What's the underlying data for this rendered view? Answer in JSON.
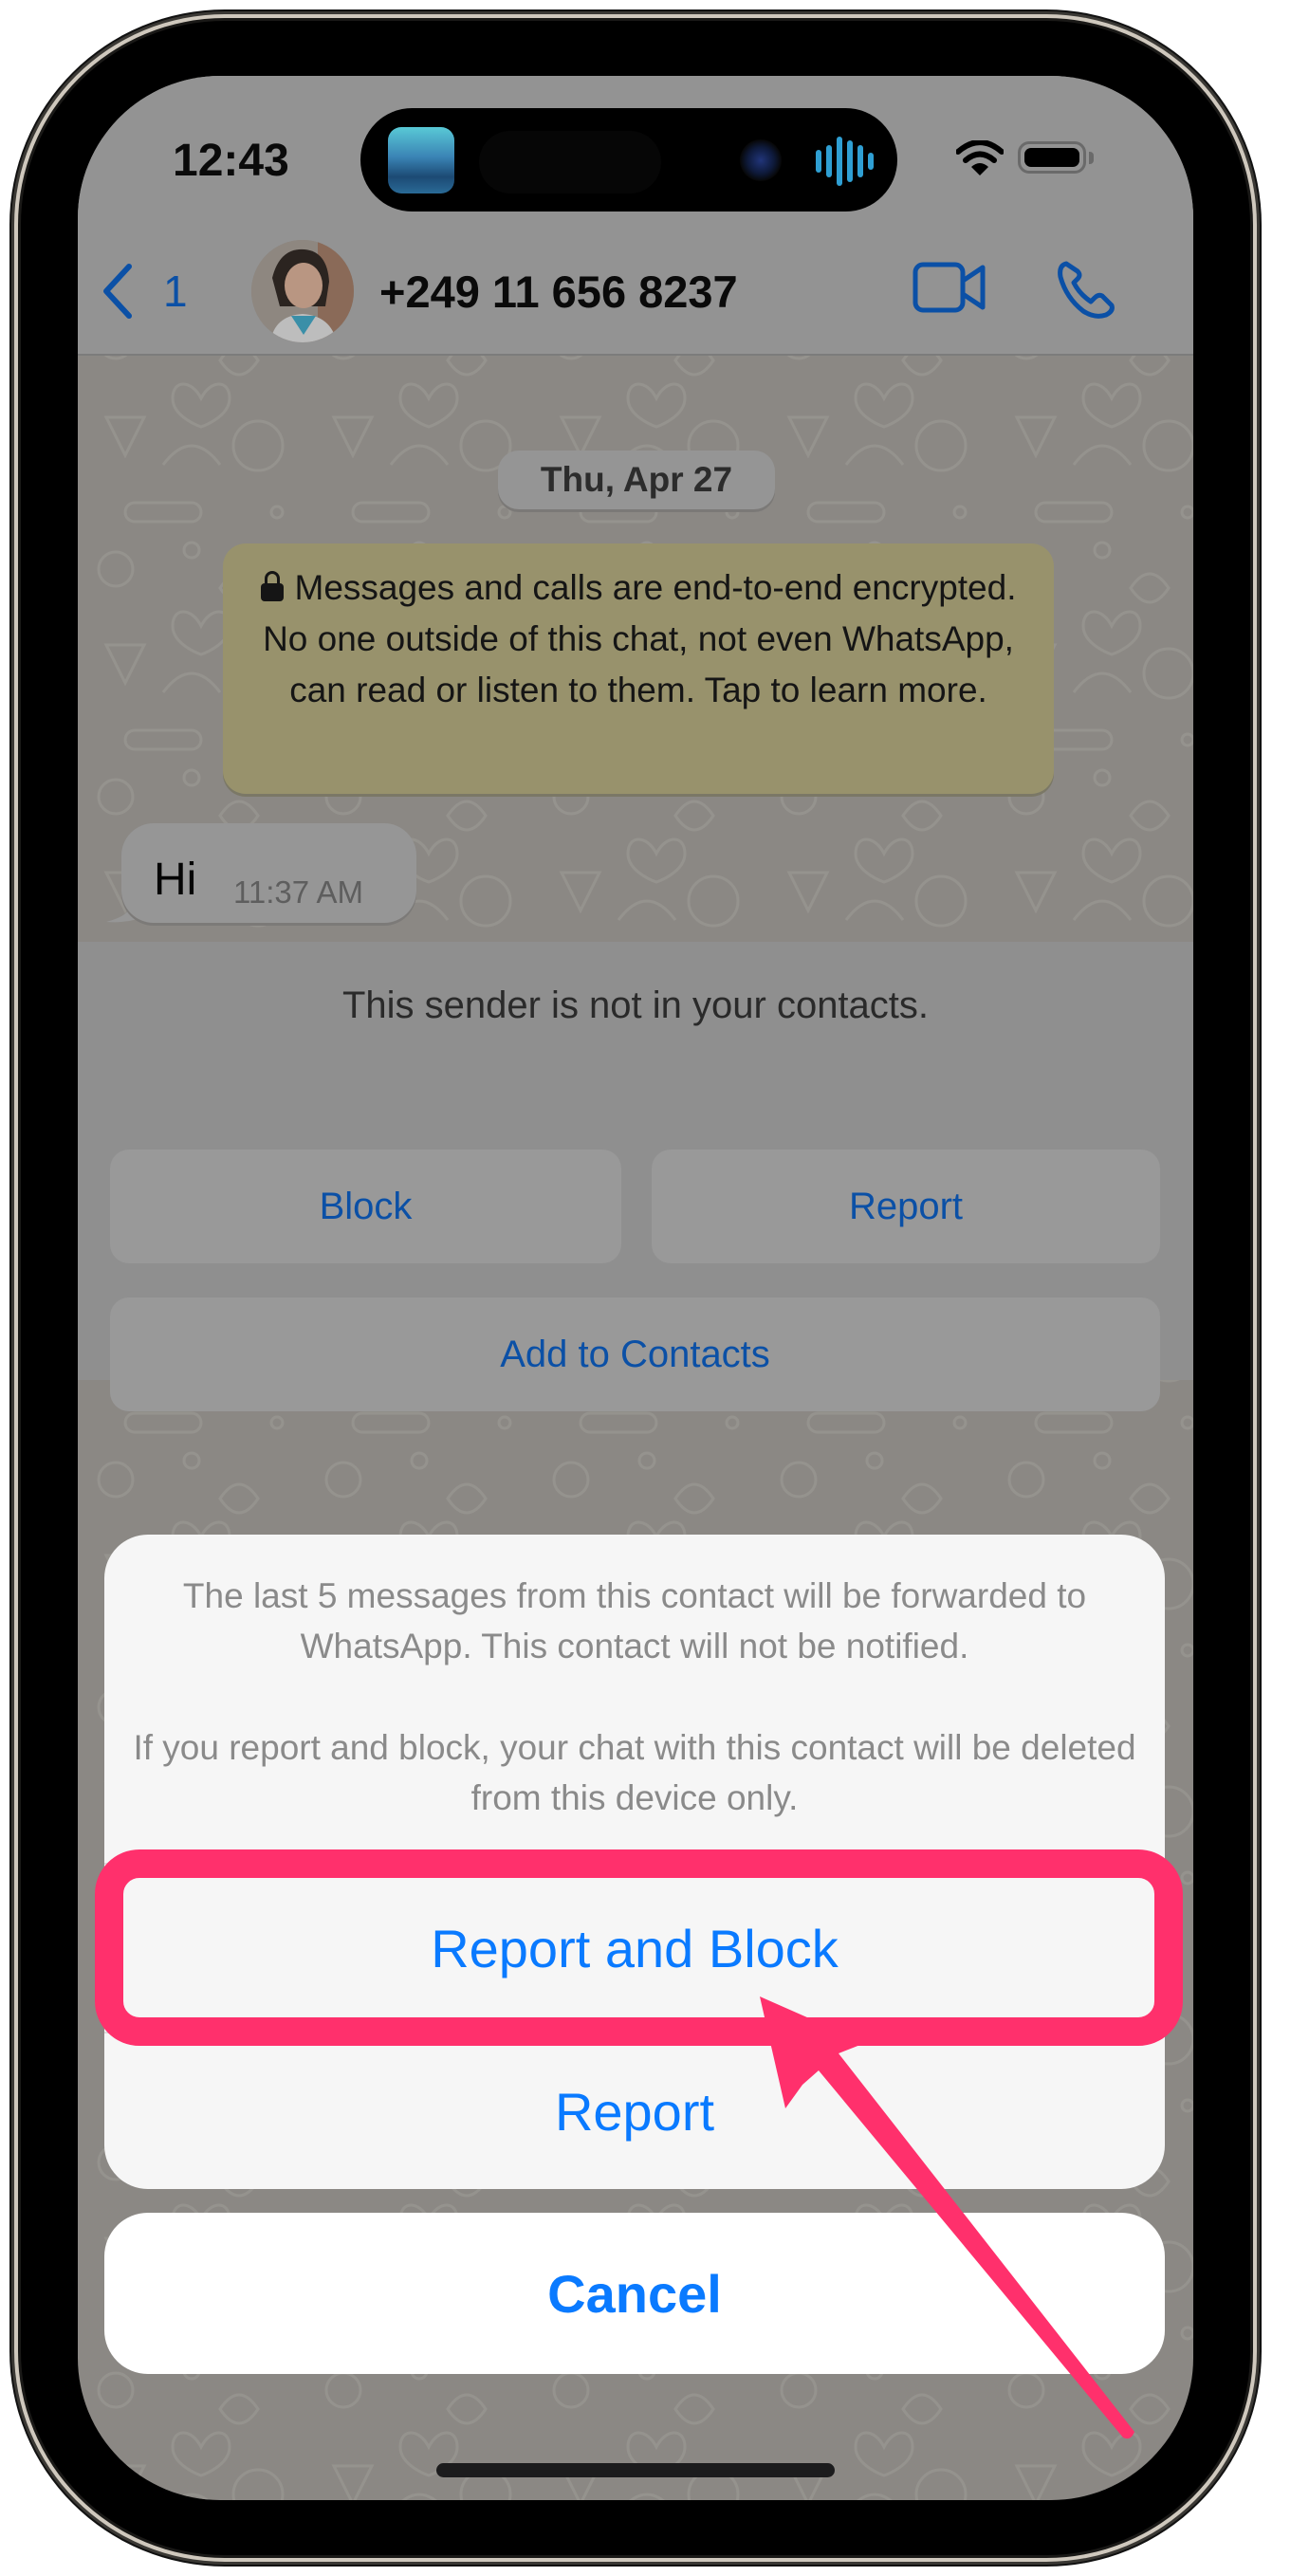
{
  "status_bar": {
    "time": "12:43",
    "icons": [
      "now-playing-artwork",
      "camera-indicator",
      "audio-waveform-icon",
      "wifi-icon",
      "battery-icon"
    ]
  },
  "header": {
    "back_count": "1",
    "contact_name": "+249 11 656 8237",
    "icons": [
      "chevron-left-icon",
      "video-call-icon",
      "phone-call-icon"
    ]
  },
  "chat": {
    "date_label": "Thu, Apr 27",
    "encryption_notice": "Messages and calls are end-to-end encrypted. No one outside of this chat, not even WhatsApp, can read or listen to them. Tap to learn more.",
    "messages": [
      {
        "text": "Hi",
        "time": "11:37 AM",
        "direction": "incoming"
      }
    ]
  },
  "unknown_sender_banner": {
    "text": "This sender is not in your contacts.",
    "block_label": "Block",
    "report_label": "Report",
    "add_contact_label": "Add to Contacts"
  },
  "action_sheet": {
    "message_paragraph_1": "The last 5 messages from this contact will be forwarded to WhatsApp. This contact will not be notified.",
    "message_paragraph_2": "If you report and block, your chat with this contact will be deleted from this device only.",
    "actions": [
      {
        "label": "Report and Block",
        "highlighted": true
      },
      {
        "label": "Report",
        "highlighted": false
      }
    ],
    "cancel_label": "Cancel"
  },
  "colors": {
    "ios_blue": "#0a7aff",
    "dimmed_blue": "#0b50a6",
    "highlight_pink": "#ff306c",
    "encryption_box": "#98926c",
    "chat_background": "#8b8884"
  }
}
